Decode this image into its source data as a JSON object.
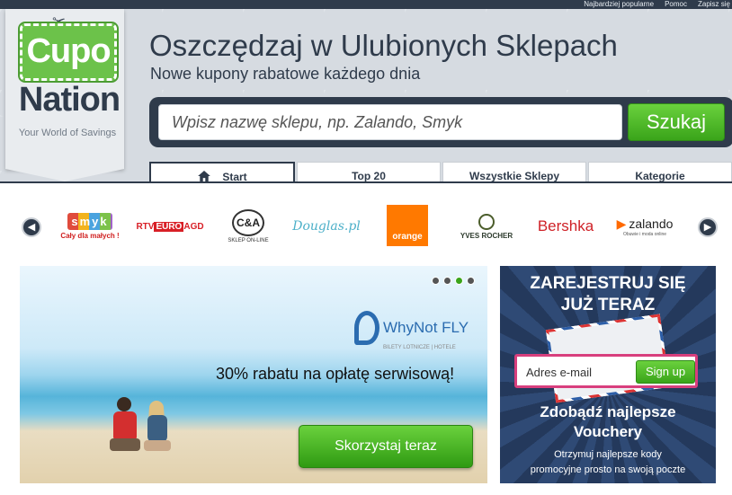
{
  "toplinks": [
    "Najbardziej popularne",
    "Pomoc",
    "Zapisz się"
  ],
  "logo": {
    "top": "Cupo",
    "bottom": "Nation",
    "tagline": "Your World of Savings"
  },
  "header": {
    "title": "Oszczędzaj w Ulubionych Sklepach",
    "subtitle": "Nowe kupony rabatowe każdego dnia"
  },
  "search": {
    "placeholder": "Wpisz nazwę sklepu, np. Zalando, Smyk",
    "button": "Szukaj"
  },
  "tabs": [
    {
      "label": "Start",
      "active": true,
      "icon": "home-icon"
    },
    {
      "label": "Top 20"
    },
    {
      "label": "Wszystkie Sklepy"
    },
    {
      "label": "Kategorie"
    }
  ],
  "brands": {
    "smyk": {
      "name": "smyk",
      "sub": "Cały dla małych !"
    },
    "rtv": {
      "prefix": "RTV",
      "mid": "EURO",
      "suffix": "AGD"
    },
    "ca": {
      "name": "C&A",
      "sub": "SKLEP ON-LINE"
    },
    "douglas": "Douglas.pl",
    "orange": "orange",
    "yves": "YVES ROCHER",
    "bershka": "Bershka",
    "zalando": {
      "name": "zalando",
      "sub": "Obuwie i moda online"
    }
  },
  "promo": {
    "brand": "WhyNot FLY",
    "brand_sub": "BILETY LOTNICZE | HOTELE",
    "text": "30% rabatu na opłatę serwisową!",
    "button": "Skorzystaj teraz",
    "active_dot": 2
  },
  "register": {
    "title_line1": "ZAREJESTRUJ SIĘ",
    "title_line2": "JUŻ TERAZ",
    "email_placeholder": "Adres e-mail",
    "button": "Sign up",
    "headline_line1": "Zdobądź najlepsze",
    "headline_line2": "Vouchery",
    "desc_line1": "Otrzymuj najlepsze kody",
    "desc_line2": "promocyjne prosto na swoją poczte"
  },
  "colors": {
    "navy": "#2f3b4b",
    "green": "#3aa41a",
    "pink": "#d83f7d"
  }
}
